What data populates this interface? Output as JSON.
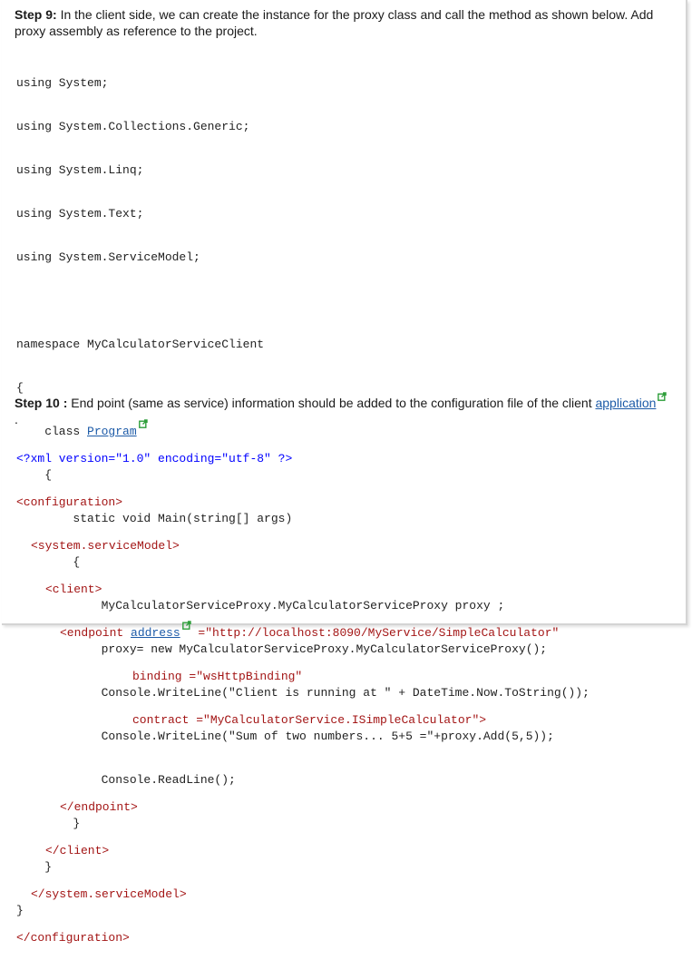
{
  "step9": {
    "label": "Step 9:",
    "text": " In the client side, we can create the instance for the proxy class and call the method as shown below. Add proxy assembly as reference to the project."
  },
  "cs_code": {
    "lines": [
      "using System;",
      "using System.Collections.Generic;",
      "using System.Linq;",
      "using System.Text;",
      "using System.ServiceModel;",
      "",
      "namespace MyCalculatorServiceClient",
      "{",
      "    class ",
      "    {",
      "        static void Main(string[] args)",
      "        {",
      "            MyCalculatorServiceProxy.MyCalculatorServiceProxy proxy ;",
      "            proxy= new MyCalculatorServiceProxy.MyCalculatorServiceProxy();",
      "            Console.WriteLine(\"Client is running at \" + DateTime.Now.ToString());",
      "            Console.WriteLine(\"Sum of two numbers... 5+5 =\"+proxy.Add(5,5));",
      "            Console.ReadLine();",
      "        }",
      "    }",
      "}"
    ],
    "program_link": "Program"
  },
  "step10": {
    "label": "Step 10 :",
    "text": " End point (same as service) information should be added to the configuration file of the client ",
    "link": "application",
    "tail": "."
  },
  "xml_code": {
    "decl": "<?xml version=\"1.0\" encoding=\"utf-8\" ?>",
    "l_config_open": "<configuration>",
    "l_sm_open": "<system.serviceModel>",
    "l_client_open": "<client>",
    "l_endpoint_prefix": "<endpoint ",
    "l_endpoint_link": "address",
    "l_endpoint_value": " =\"http://localhost:8090/MyService/SimpleCalculator\"",
    "l_binding": "binding =\"wsHttpBinding\"",
    "l_contract": "contract =\"MyCalculatorService.ISimpleCalculator\">",
    "l_endpoint_close": "</endpoint>",
    "l_client_close": "</client>",
    "l_sm_close": "</system.serviceModel>",
    "l_config_close": "</configuration>"
  },
  "colors": {
    "link": "#1d5ba8",
    "ext_icon": "#2e9e3a",
    "xml_tag": "#a31515",
    "xml_value": "#a31515"
  },
  "icons": [
    "external-link-icon"
  ]
}
